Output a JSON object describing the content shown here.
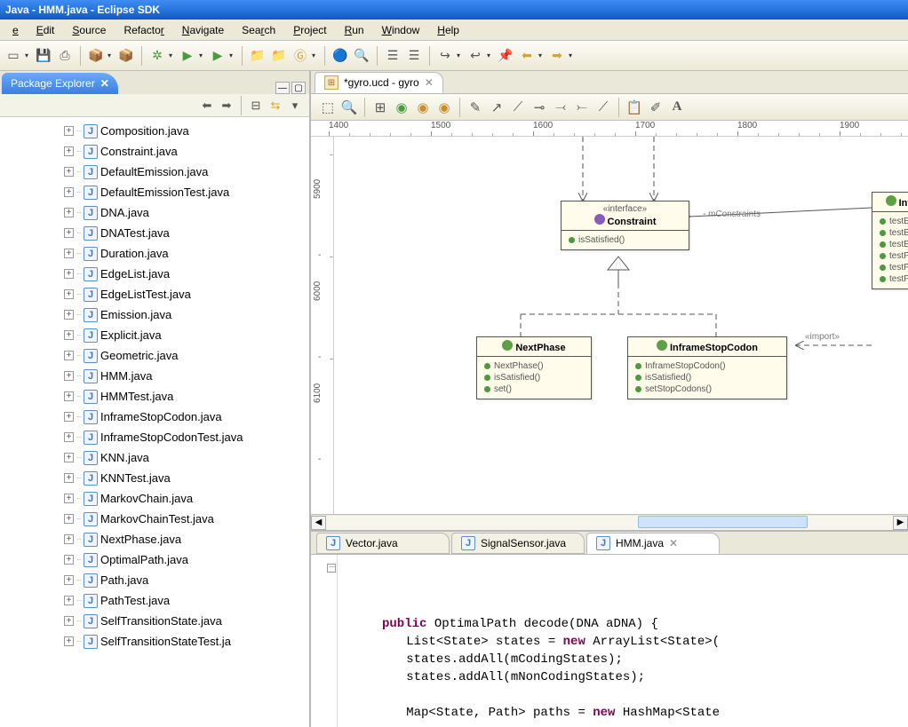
{
  "title": "Java - HMM.java - Eclipse SDK",
  "menu": [
    "e",
    "Edit",
    "Source",
    "Refactor",
    "Navigate",
    "Search",
    "Project",
    "Run",
    "Window",
    "Help"
  ],
  "menu_underline": [
    0,
    0,
    0,
    7,
    0,
    3,
    0,
    0,
    0,
    0
  ],
  "explorer": {
    "tab": "Package Explorer",
    "files": [
      "Composition.java",
      "Constraint.java",
      "DefaultEmission.java",
      "DefaultEmissionTest.java",
      "DNA.java",
      "DNATest.java",
      "Duration.java",
      "EdgeList.java",
      "EdgeListTest.java",
      "Emission.java",
      "Explicit.java",
      "Geometric.java",
      "HMM.java",
      "HMMTest.java",
      "InframeStopCodon.java",
      "InframeStopCodonTest.java",
      "KNN.java",
      "KNNTest.java",
      "MarkovChain.java",
      "MarkovChainTest.java",
      "NextPhase.java",
      "OptimalPath.java",
      "Path.java",
      "PathTest.java",
      "SelfTransitionState.java",
      "SelfTransitionStateTest.ja"
    ]
  },
  "diagram": {
    "tab": "*gyro.ucd - gyro",
    "ruler_h": [
      1400,
      1500,
      1600,
      1700,
      1800,
      1900
    ],
    "ruler_v": [
      5900,
      6000,
      6100
    ],
    "constraint": {
      "stereo": "«interface»",
      "name": "Constraint",
      "methods": [
        "isSatisfied()"
      ]
    },
    "nextphase": {
      "name": "NextPhase",
      "methods": [
        "NextPhase()",
        "isSatisfied()",
        "set()"
      ]
    },
    "inframe": {
      "name": "InframeStopCodon",
      "methods": [
        "InframeStopCodon()",
        "isSatisfied()",
        "setStopCodons()"
      ]
    },
    "infra": {
      "name": "Infra",
      "methods": [
        "testE",
        "testE",
        "testE",
        "testP",
        "testP",
        "testP"
      ]
    },
    "labels": {
      "mConstraints": "- mConstraints",
      "import": "«import»"
    }
  },
  "bottom": {
    "tabs": [
      "Vector.java",
      "SignalSensor.java",
      "HMM.java"
    ],
    "active": 2,
    "code": {
      "l1a": "public",
      "l1b": " OptimalPath decode(DNA aDNA) {",
      "l2a": "        List<State> states = ",
      "l2b": "new",
      "l2c": " ArrayList<State>(",
      "l3": "        states.addAll(mCodingStates);",
      "l4": "        states.addAll(mNonCodingStates);",
      "l5a": "        Map<State, Path> paths = ",
      "l5b": "new",
      "l5c": " HashMap<State"
    }
  }
}
